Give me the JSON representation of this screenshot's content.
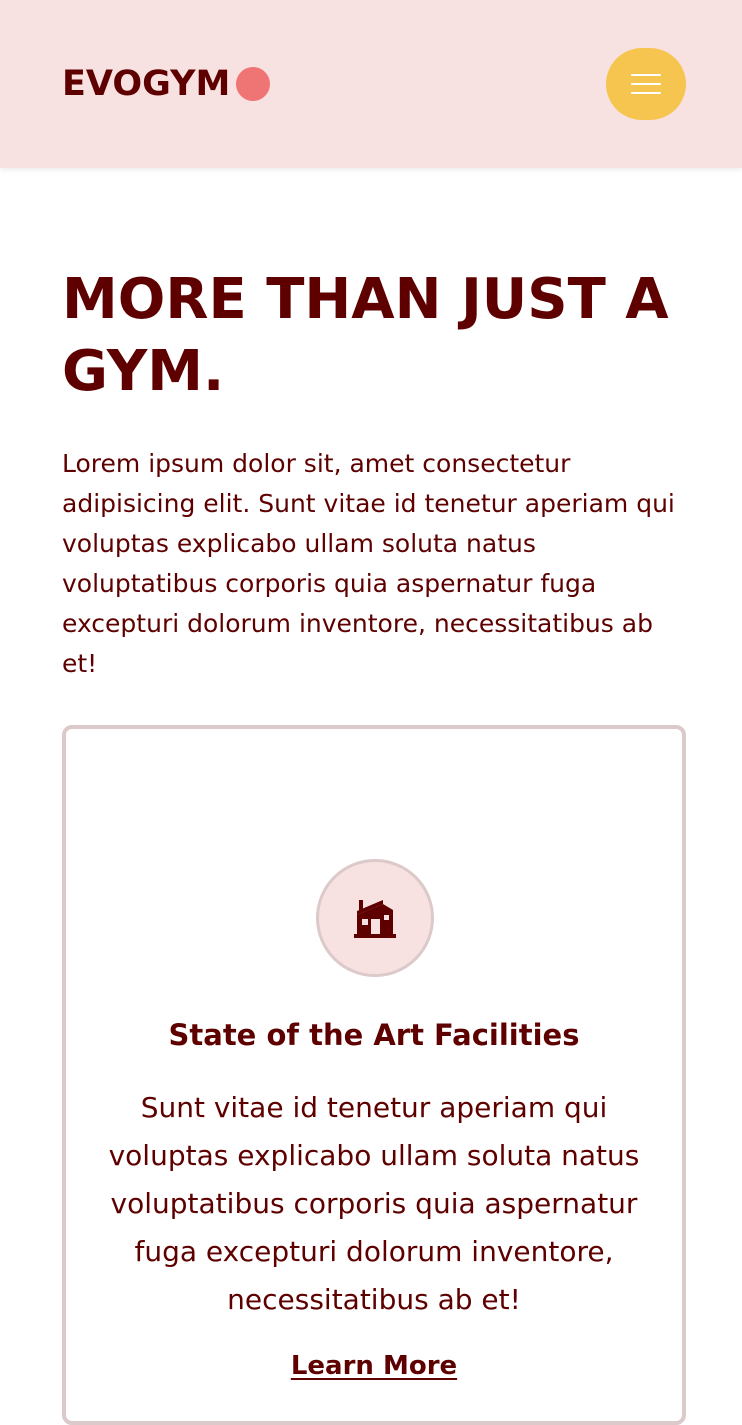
{
  "header": {
    "logo_text": "EVOGYM",
    "menu_icon": "hamburger-menu-icon"
  },
  "hero": {
    "title": "MORE THAN JUST A GYM.",
    "description": "Lorem ipsum dolor sit, amet consectetur adipisicing elit. Sunt vitae id tenetur aperiam qui voluptas explicabo ullam soluta natus voluptatibus corporis quia aspernatur fuga excepturi dolorum inventore, necessitatibus ab et!"
  },
  "benefit_card": {
    "icon": "home-modern-icon",
    "title": "State of the Art Facilities",
    "description": "Sunt vitae id tenetur aperiam qui voluptas explicabo ullam soluta natus voluptatibus corporis quia aspernatur fuga excepturi dolorum inventore, necessitatibus ab et!",
    "link_label": "Learn More"
  },
  "colors": {
    "primary_text": "#5e0000",
    "navbar_bg": "#f8e1e1",
    "accent_yellow": "#f6c550",
    "logo_dot": "#ef7474",
    "card_border": "#dcc9c9"
  }
}
